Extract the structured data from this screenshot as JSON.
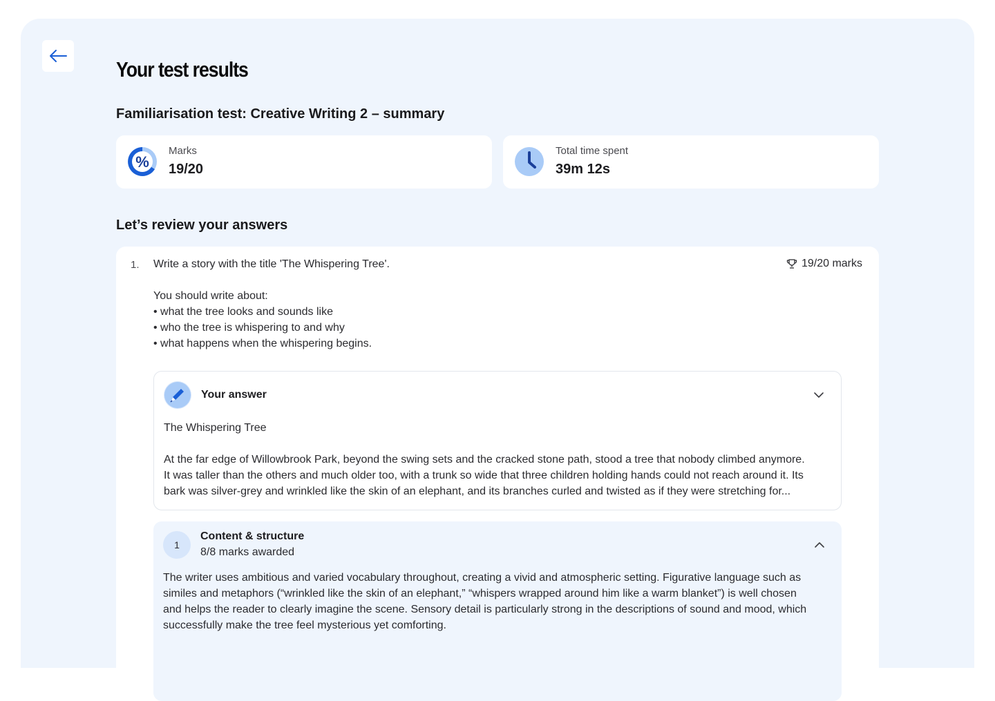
{
  "page": {
    "title": "Your test results",
    "summary_title": "Familiarisation test: Creative Writing 2 – summary",
    "review_title": "Let’s review your answers"
  },
  "stats": {
    "marks": {
      "label": "Marks",
      "value": "19/20",
      "icon": "percent-icon"
    },
    "time": {
      "label": "Total time spent",
      "value": "39m 12s",
      "icon": "clock-icon"
    }
  },
  "question": {
    "number": "1.",
    "marks": "19/20 marks",
    "prompt": "Write a story with the title 'The Whispering Tree'.",
    "intro": "You should write about:",
    "bullets": [
      "• what the tree looks and sounds like",
      "• who the tree is whispering to and why",
      "• what happens when the whispering begins."
    ]
  },
  "answer": {
    "heading": "Your answer",
    "title": "The Whispering Tree",
    "lines": [
      "At the far edge of Willowbrook Park, beyond the swing sets and the cracked stone path, stood a tree that nobody climbed anymore.",
      "It was taller than the others and much older too, with a trunk so wide that three children holding hands could not reach around it. Its",
      "bark was silver-grey and wrinkled like the skin of an elephant, and its branches curled and twisted as if they were stretching for..."
    ]
  },
  "feedback": {
    "index": "1",
    "title": "Content & structure",
    "marks": "8/8 marks awarded",
    "lines": [
      "The writer uses ambitious and varied vocabulary throughout, creating a vivid and atmospheric setting. Figurative language such as",
      "similes and metaphors (“wrinkled like the skin of an elephant,” “whispers wrapped around him like a warm blanket”) is well chosen",
      "and helps the reader to clearly imagine the scene. Sensory detail is particularly strong in the descriptions of sound and mood, which",
      "successfully make the tree feel mysterious yet comforting."
    ]
  },
  "colors": {
    "accent": "#1a5fd6",
    "accent_light": "#a9cbf7",
    "panel_bg": "#eff5fd"
  }
}
